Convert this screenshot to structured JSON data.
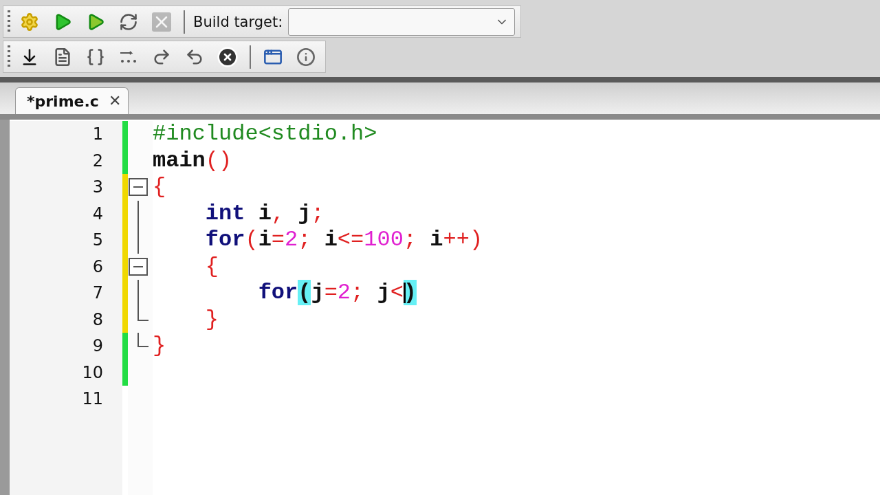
{
  "build_toolbar": {
    "buttons": [
      {
        "kind": "build",
        "disabled": false
      },
      {
        "kind": "run",
        "disabled": false
      },
      {
        "kind": "build-run",
        "disabled": false
      },
      {
        "kind": "rebuild",
        "disabled": false
      },
      {
        "kind": "abort",
        "disabled": true
      }
    ],
    "target_label": "Build target:"
  },
  "debug_toolbar": {
    "buttons": [
      {
        "kind": "run-to-cursor",
        "disabled": false
      },
      {
        "kind": "next-line",
        "disabled": false
      },
      {
        "kind": "step-into",
        "disabled": false
      },
      {
        "kind": "next-instruction",
        "disabled": false
      },
      {
        "kind": "step-out",
        "disabled": false
      },
      {
        "kind": "step-over-brace",
        "disabled": false
      },
      {
        "kind": "stop",
        "disabled": false
      },
      {
        "kind": "window",
        "disabled": false
      },
      {
        "kind": "info",
        "disabled": false
      }
    ]
  },
  "tabs": [
    {
      "label": "*prime.c",
      "selected": true,
      "close": "✕"
    }
  ],
  "editor": {
    "lines": [
      {
        "number": "1",
        "color": "#22dd44",
        "kind": "plain",
        "tokens": [
          {
            "kind": "directive",
            "text": "#include<stdio.h>"
          }
        ]
      },
      {
        "number": "2",
        "color": "#22dd44",
        "kind": "plain",
        "tokens": [
          {
            "kind": "name",
            "text": "main"
          },
          {
            "kind": "symbol",
            "text": "()"
          }
        ]
      },
      {
        "number": "3",
        "color": "#f0d800",
        "kind": "fold-start",
        "tokens": [
          {
            "kind": "symbol",
            "text": "{"
          }
        ]
      },
      {
        "number": "4",
        "color": "#f0d800",
        "kind": "fold-body",
        "tokens": [
          {
            "kind": "keyword",
            "text": "    int"
          },
          {
            "kind": "name",
            "text": " i"
          },
          {
            "kind": "symbol",
            "text": ","
          },
          {
            "kind": "name",
            "text": " j"
          },
          {
            "kind": "symbol",
            "text": ";"
          }
        ]
      },
      {
        "number": "5",
        "color": "#f0d800",
        "kind": "fold-body",
        "tokens": [
          {
            "kind": "keyword",
            "text": "    for"
          },
          {
            "kind": "symbol",
            "text": "("
          },
          {
            "kind": "name",
            "text": "i"
          },
          {
            "kind": "symbol",
            "text": "="
          },
          {
            "kind": "number",
            "text": "2"
          },
          {
            "kind": "symbol",
            "text": "; "
          },
          {
            "kind": "name",
            "text": "i"
          },
          {
            "kind": "symbol",
            "text": "<="
          },
          {
            "kind": "number",
            "text": "100"
          },
          {
            "kind": "symbol",
            "text": "; "
          },
          {
            "kind": "name",
            "text": "i"
          },
          {
            "kind": "symbol",
            "text": "++)"
          }
        ]
      },
      {
        "number": "6",
        "color": "#f0d800",
        "kind": "fold-start",
        "tokens": [
          {
            "kind": "symbol",
            "text": "    {"
          }
        ]
      },
      {
        "number": "7",
        "color": "#f0d800",
        "kind": "fold-body",
        "caret": true,
        "tokens": [
          {
            "kind": "keyword",
            "text": "        for"
          },
          {
            "kind": "matched",
            "text": "("
          },
          {
            "kind": "name",
            "text": "j"
          },
          {
            "kind": "symbol",
            "text": "="
          },
          {
            "kind": "number",
            "text": "2"
          },
          {
            "kind": "symbol",
            "text": "; "
          },
          {
            "kind": "name",
            "text": "j"
          },
          {
            "kind": "symbol",
            "text": "<"
          },
          {
            "kind": "matched",
            "text": ")"
          }
        ]
      },
      {
        "number": "8",
        "color": "#f0d800",
        "kind": "fold-end",
        "tokens": [
          {
            "kind": "symbol",
            "text": "    }"
          }
        ]
      },
      {
        "number": "9",
        "color": "#22dd44",
        "kind": "fold-end",
        "tokens": [
          {
            "kind": "symbol",
            "text": "}"
          }
        ]
      },
      {
        "number": "10",
        "color": "#22dd44",
        "kind": "plain"
      },
      {
        "number": "11",
        "kind": "plain"
      }
    ]
  }
}
